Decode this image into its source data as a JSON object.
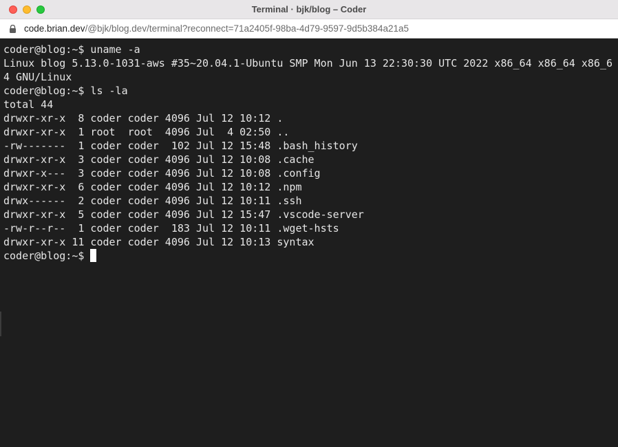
{
  "window": {
    "title": "Terminal · bjk/blog – Coder"
  },
  "address_bar": {
    "host": "code.brian.dev",
    "path": "/@bjk/blog.dev/terminal?reconnect=71a2405f-98ba-4d79-9597-9d5b384a21a5",
    "icon": "lock-icon"
  },
  "terminal": {
    "lines": [
      "coder@blog:~$ uname -a",
      "Linux blog 5.13.0-1031-aws #35~20.04.1-Ubuntu SMP Mon Jun 13 22:30:30 UTC 2022 x86_64 x86_64 x86_6",
      "4 GNU/Linux",
      "coder@blog:~$ ls -la",
      "total 44",
      "drwxr-xr-x  8 coder coder 4096 Jul 12 10:12 .",
      "drwxr-xr-x  1 root  root  4096 Jul  4 02:50 ..",
      "-rw-------  1 coder coder  102 Jul 12 15:48 .bash_history",
      "drwxr-xr-x  3 coder coder 4096 Jul 12 10:08 .cache",
      "drwxr-x---  3 coder coder 4096 Jul 12 10:08 .config",
      "drwxr-xr-x  6 coder coder 4096 Jul 12 10:12 .npm",
      "drwx------  2 coder coder 4096 Jul 12 10:11 .ssh",
      "drwxr-xr-x  5 coder coder 4096 Jul 12 15:47 .vscode-server",
      "-rw-r--r--  1 coder coder  183 Jul 12 10:11 .wget-hsts",
      "drwxr-xr-x 11 coder coder 4096 Jul 12 10:13 syntax"
    ],
    "prompt": "coder@blog:~$"
  }
}
